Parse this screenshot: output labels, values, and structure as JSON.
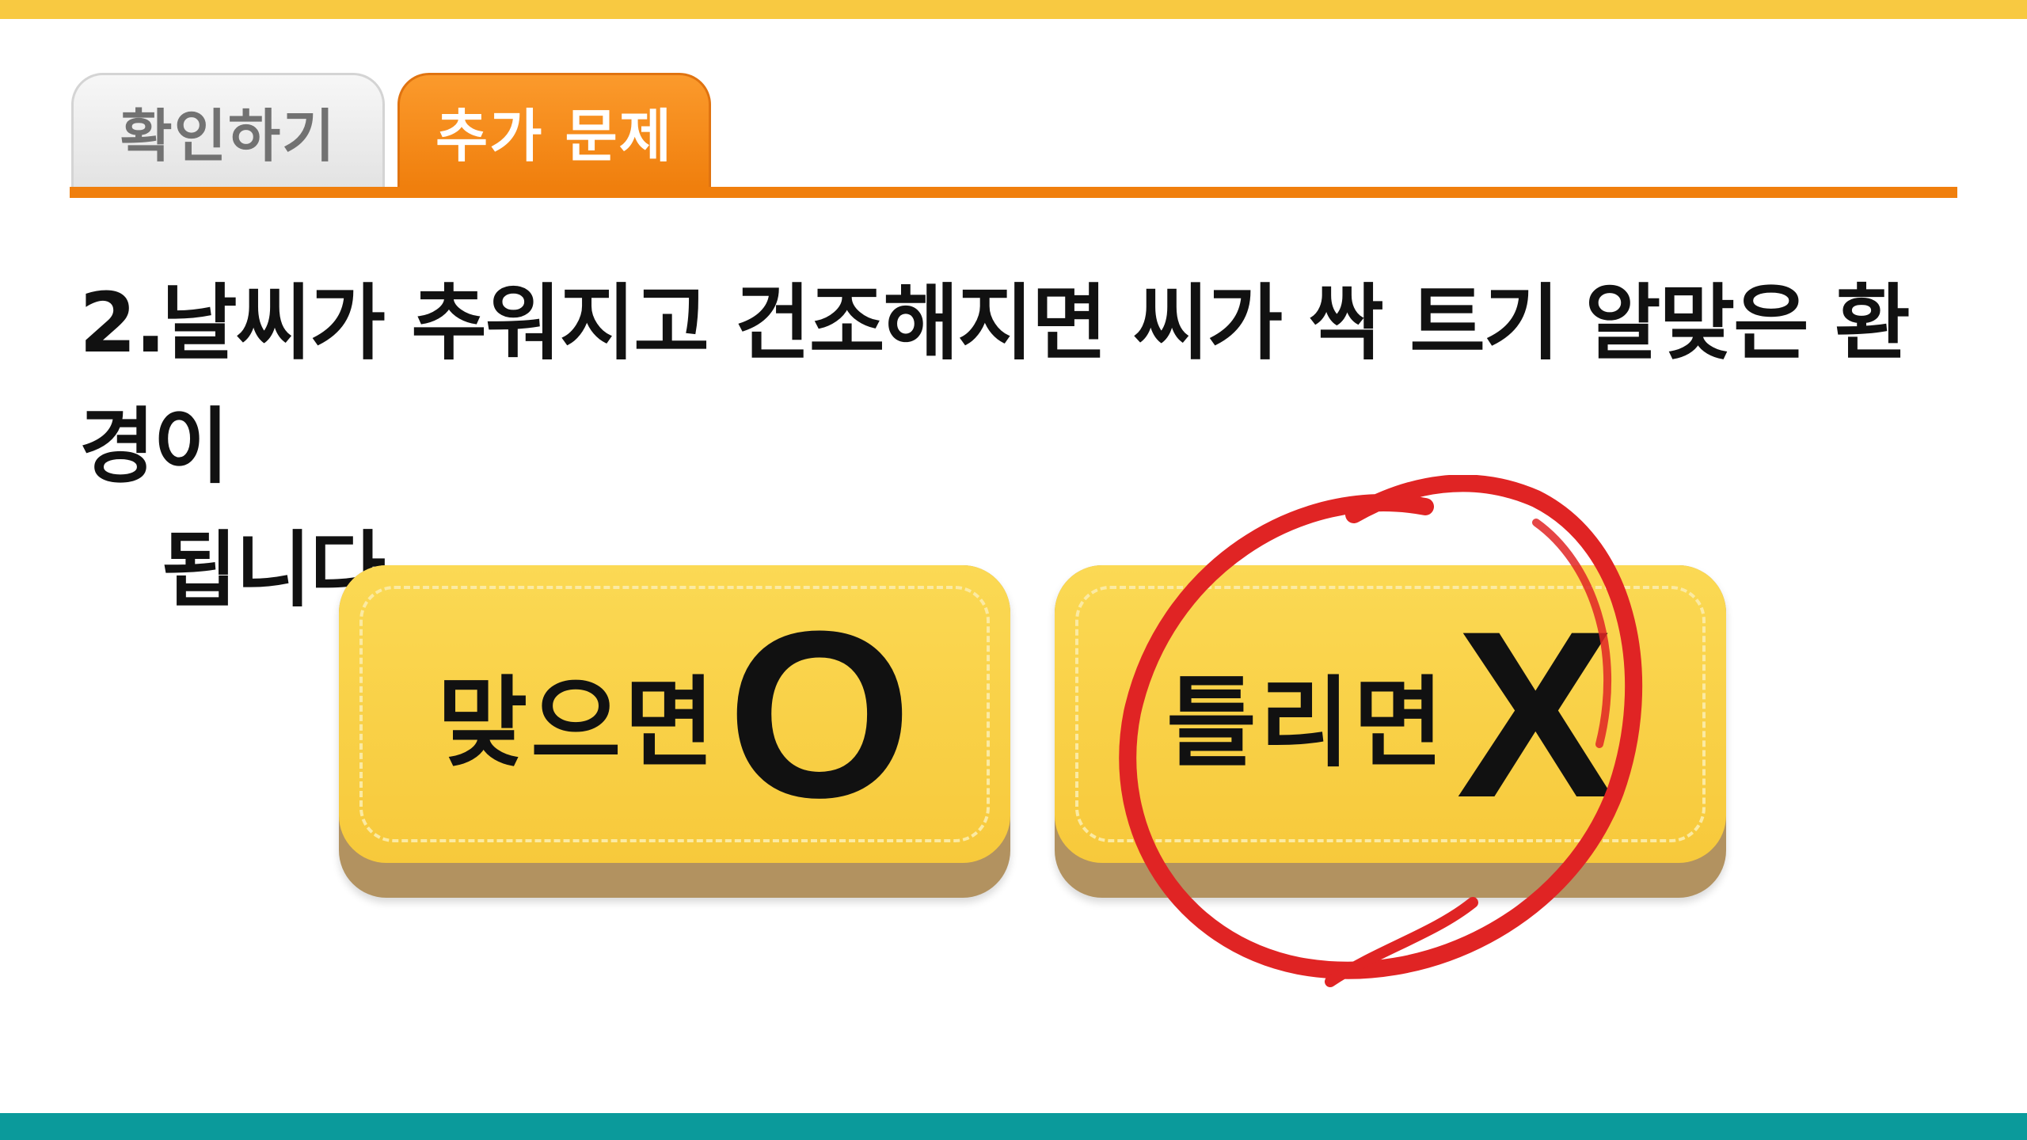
{
  "tabs": [
    {
      "label": "확인하기",
      "active": false
    },
    {
      "label": "추가 문제",
      "active": true
    }
  ],
  "question": {
    "number": "2.",
    "line1": "날씨가 추워지고 건조해지면 씨가 싹 트기 알맞은 환경이",
    "line2": "됩니다."
  },
  "answers": {
    "correct": {
      "word": "맞으면",
      "mark": "O"
    },
    "wrong": {
      "word": "틀리면",
      "mark": "X"
    }
  },
  "selected_answer": "X",
  "colors": {
    "top_bar": "#f8c941",
    "bottom_bar": "#0b9a9b",
    "accent_orange": "#f07f0d",
    "button_yellow": "#f9d04a",
    "selection_red": "#e02424"
  }
}
